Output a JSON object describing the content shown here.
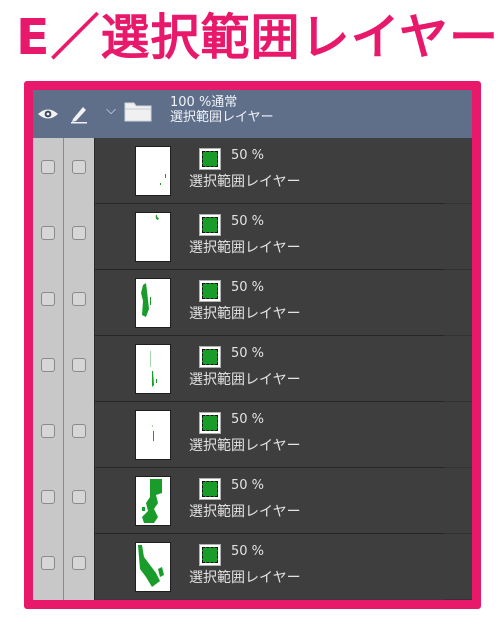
{
  "headline": "E／選択範囲レイヤー",
  "colors": {
    "accent": "#e8186b",
    "panel_bg": "#3a3a3a",
    "folder_bg": "#5f6f8a",
    "selection_green": "#1a9c2a"
  },
  "panel": {
    "header": {
      "eye_icon": "eye-icon",
      "lock_icon": "pen-icon",
      "folder_icon": "folder-icon",
      "expand_icon": "chevron-down-icon"
    },
    "folder": {
      "opacity_blend": "100 %通常",
      "name": "選択範囲レイヤー"
    },
    "layers": [
      {
        "opacity": "50 %",
        "name": "選択範囲レイヤー",
        "icon": "selection-layer-icon"
      },
      {
        "opacity": "50 %",
        "name": "選択範囲レイヤー",
        "icon": "selection-layer-icon"
      },
      {
        "opacity": "50 %",
        "name": "選択範囲レイヤー",
        "icon": "selection-layer-icon"
      },
      {
        "opacity": "50 %",
        "name": "選択範囲レイヤー",
        "icon": "selection-layer-icon"
      },
      {
        "opacity": "50 %",
        "name": "選択範囲レイヤー",
        "icon": "selection-layer-icon"
      },
      {
        "opacity": "50 %",
        "name": "選択範囲レイヤー",
        "icon": "selection-layer-icon"
      },
      {
        "opacity": "50 %",
        "name": "選択範囲レイヤー",
        "icon": "selection-layer-icon"
      }
    ]
  }
}
